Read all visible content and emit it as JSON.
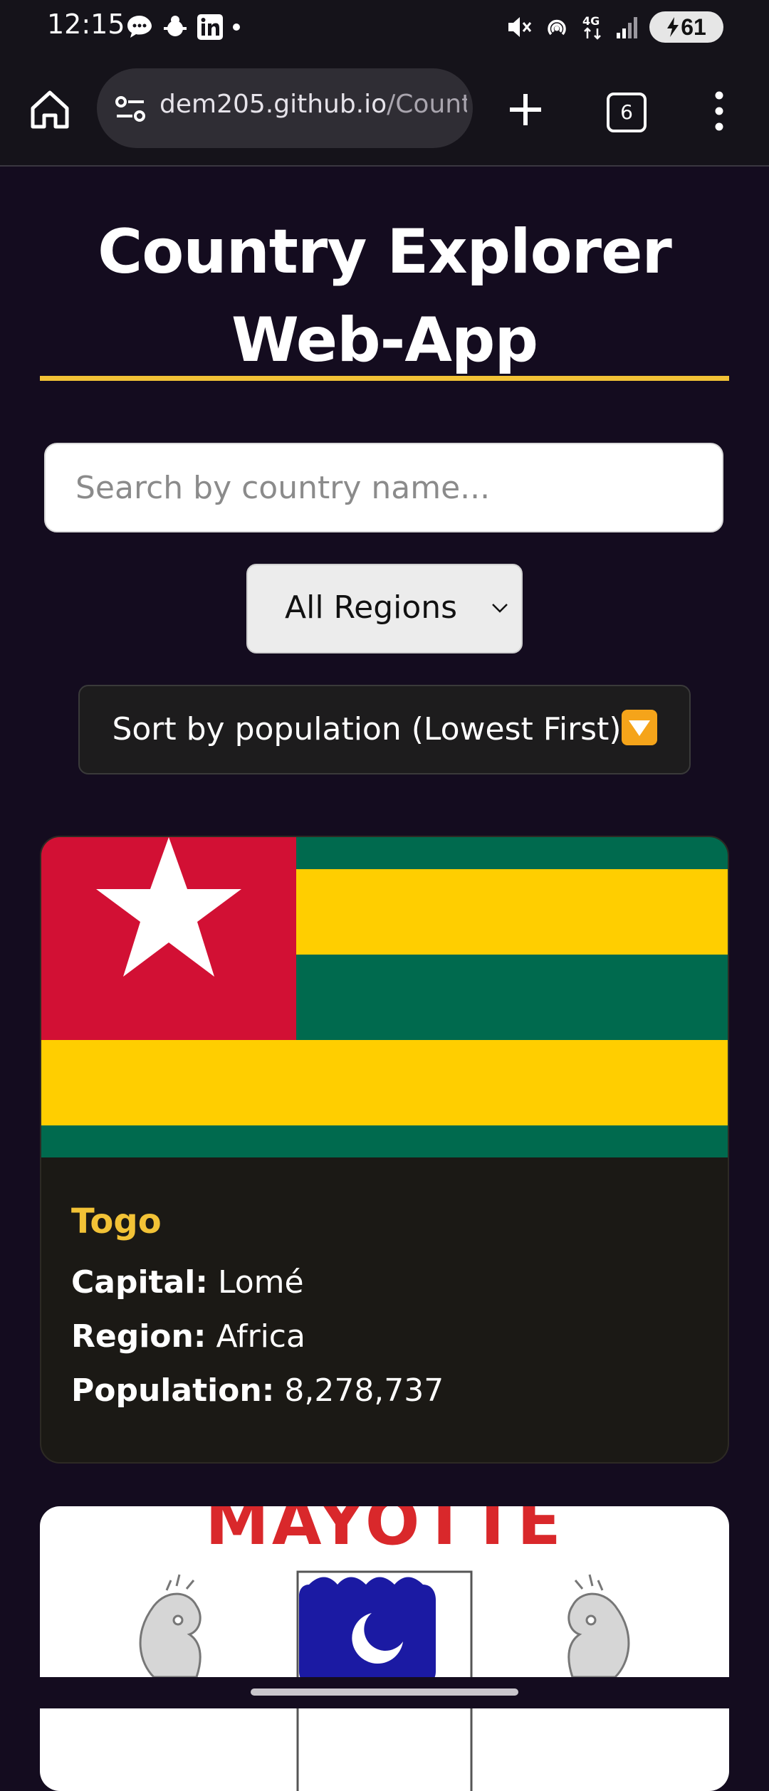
{
  "status_bar": {
    "time": "12:15",
    "network": "4G",
    "battery": "61",
    "icons": [
      "messages-icon",
      "settings-bug-icon",
      "linkedin-icon",
      "dot-icon",
      "mute-icon",
      "hotspot-icon",
      "network-4g-icon",
      "signal-icon",
      "battery-charging-icon"
    ]
  },
  "browser": {
    "url_host": "dem205.github.io",
    "url_path": "/Country",
    "tab_count": "6",
    "icons": [
      "home-icon",
      "site-settings-icon",
      "plus-icon",
      "tabs-icon",
      "more-vert-icon"
    ]
  },
  "page": {
    "title": "Country Explorer Web-App",
    "search": {
      "placeholder": "Search by country name..."
    },
    "region_filter": {
      "selected": "All Regions"
    },
    "sort_button": {
      "label": "Sort by population (Lowest First)",
      "emoji": "down-triangle-emoji-icon"
    }
  },
  "countries": [
    {
      "name": "Togo",
      "capital_label": "Capital:",
      "capital": "Lomé",
      "region_label": "Region:",
      "region": "Africa",
      "population_label": "Population:",
      "population": "8,278,737",
      "flag_colors": {
        "green": "#006a4e",
        "yellow": "#ffce00",
        "red": "#d21034",
        "white": "#ffffff"
      }
    },
    {
      "flag_text": "MAYOTTE",
      "flag_colors": {
        "red": "#d9282b",
        "blue": "#1b1aa3",
        "white": "#ffffff"
      }
    }
  ],
  "colors": {
    "background": "#140c1f",
    "accent": "#f2c236",
    "card": "#1b1915"
  }
}
